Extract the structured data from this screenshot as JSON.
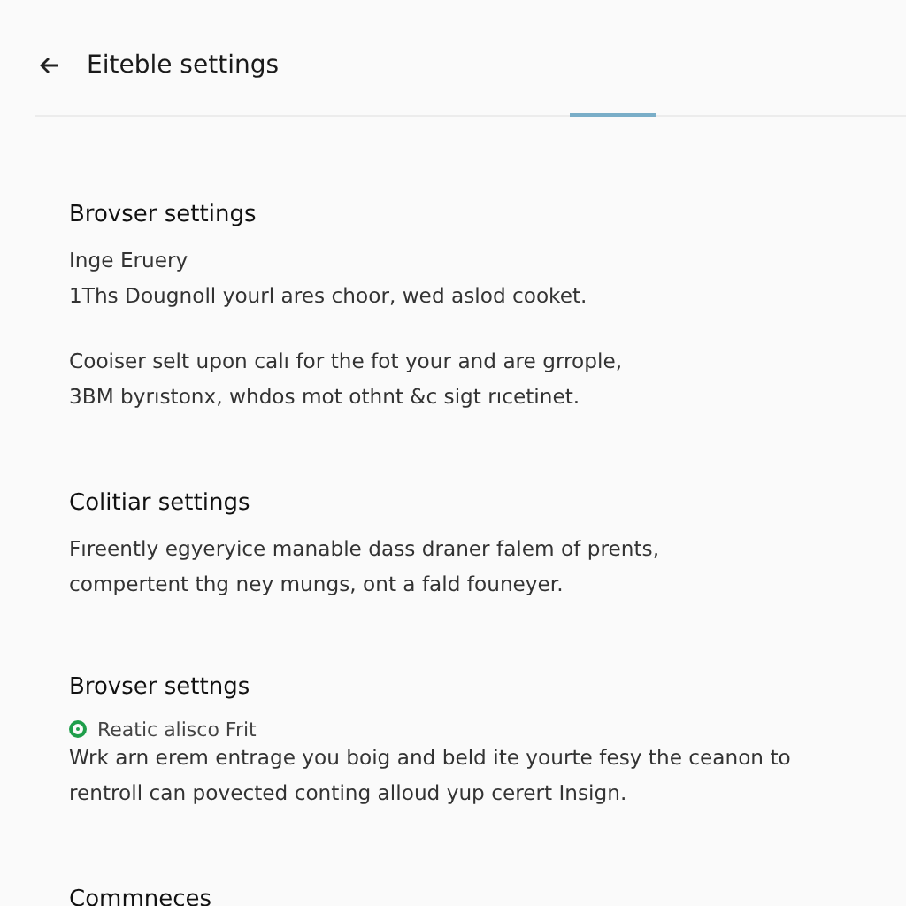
{
  "header": {
    "title": "Eiteble settings"
  },
  "sections": [
    {
      "heading": "Brovser settings",
      "items": [
        {
          "kind": "text",
          "text": "Inge Eruery"
        },
        {
          "kind": "text",
          "text": "1Ths Dougnoll yourl ares choor, wed aslod cooket."
        },
        {
          "kind": "gap"
        },
        {
          "kind": "text",
          "text": "Cooiser selt upon calı for the fot your and are grrople,"
        },
        {
          "kind": "text",
          "text": "3BM byrıstonx, whdos mot othnt &c sigt rıcetinet."
        }
      ]
    },
    {
      "heading": "Colitiar settings",
      "items": [
        {
          "kind": "text",
          "text": "Fıreently egyeryice manable dass draner falem of prents,"
        },
        {
          "kind": "text",
          "text": "compertent thg ney mungs, ont a fald founeyer."
        }
      ]
    },
    {
      "heading": "Brovser settngs",
      "items": [
        {
          "kind": "status",
          "text": "Reatic alisco Frit",
          "color": "#1e9e4a"
        },
        {
          "kind": "text",
          "text": "Wrk arn erem entrage you boig and beld ite yourte fesy the ceanon to"
        },
        {
          "kind": "text",
          "text": "rentroll can povected conting alloud yup cerert Insign."
        }
      ]
    },
    {
      "heading": "Commneces"
    }
  ]
}
